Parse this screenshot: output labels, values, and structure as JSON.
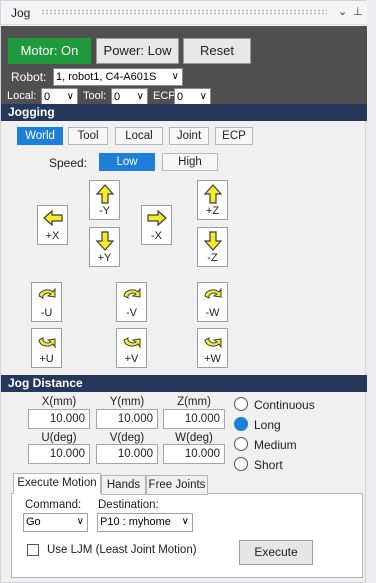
{
  "window": {
    "title": "Jog",
    "pin_icon": "pin-icon",
    "menu_icon": "chevron-down-icon"
  },
  "header": {
    "motor": "Motor: On",
    "power": "Power: Low",
    "reset": "Reset",
    "robot_label": "Robot:",
    "robot_value": "1, robot1, C4-A601S",
    "local_label": "Local:",
    "local_value": "0",
    "tool_label": "Tool:",
    "tool_value": "0",
    "ecp_label": "ECP:",
    "ecp_value": "0",
    "accent_motor": "#1e9a3c"
  },
  "jogging": {
    "title": "Jogging",
    "modes": [
      "World",
      "Tool",
      "Local",
      "Joint",
      "ECP"
    ],
    "selected_mode": "World",
    "speed_label": "Speed:",
    "speed_low": "Low",
    "speed_high": "High",
    "buttons": {
      "mx": "+X",
      "my": "-Y",
      "py": "+Y",
      "px": "-X",
      "pz": "+Z",
      "mz": "-Z",
      "mu": "-U",
      "mv": "-V",
      "mw": "-W",
      "pu": "+U",
      "pv": "+V",
      "pw": "+W"
    }
  },
  "distance": {
    "title": "Jog Distance",
    "x_label": "X(mm)",
    "y_label": "Y(mm)",
    "z_label": "Z(mm)",
    "u_label": "U(deg)",
    "v_label": "V(deg)",
    "w_label": "W(deg)",
    "x": "10.000",
    "y": "10.000",
    "z": "10.000",
    "u": "10.000",
    "v": "10.000",
    "w": "10.000",
    "options": [
      "Continuous",
      "Long",
      "Medium",
      "Short"
    ],
    "selected": "Long"
  },
  "bottom": {
    "tabs": [
      "Execute Motion",
      "Hands",
      "Free Joints"
    ],
    "command_label": "Command:",
    "command_value": "Go",
    "destination_label": "Destination:",
    "destination_value": "P10 : myhome",
    "ljm_label": "Use LJM (Least Joint Motion)",
    "execute": "Execute"
  }
}
